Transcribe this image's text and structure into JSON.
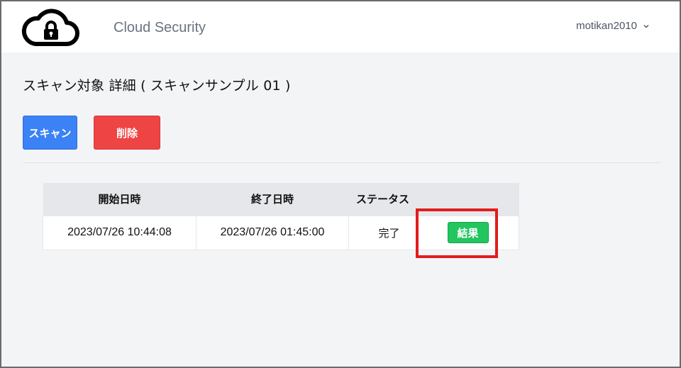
{
  "header": {
    "brand": "Cloud Security",
    "username": "motikan2010"
  },
  "page": {
    "title": "スキャン対象 詳細 ( スキャンサンプル 01 )"
  },
  "actions": {
    "scan_label": "スキャン",
    "delete_label": "削除"
  },
  "table": {
    "headers": [
      "開始日時",
      "終了日時",
      "ステータス",
      ""
    ],
    "rows": [
      {
        "start": "2023/07/26 10:44:08",
        "end": "2023/07/26 01:45:00",
        "status": "完了",
        "result_label": "結果"
      }
    ]
  },
  "colors": {
    "scan_button": "#3b82f6",
    "delete_button": "#ef4444",
    "result_button": "#22c55e",
    "highlight_box": "#e11d1d"
  },
  "icons": {
    "logo": "cloud-lock-icon",
    "user_menu": "chevron-down-icon"
  }
}
